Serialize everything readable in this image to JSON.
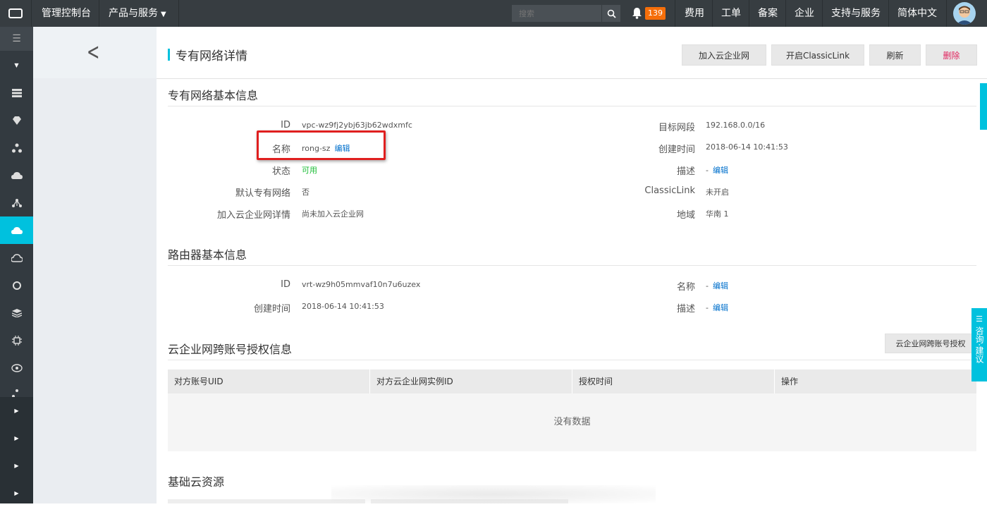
{
  "topbar": {
    "console": "管理控制台",
    "products": "产品与服务",
    "search_placeholder": "搜索",
    "notif_count": "139",
    "menu": [
      "费用",
      "工单",
      "备案",
      "企业",
      "支持与服务",
      "简体中文"
    ]
  },
  "page": {
    "title": "专有网络详情",
    "actions": {
      "join": "加入云企业网",
      "classiclink": "开启ClassicLink",
      "refresh": "刷新",
      "delete": "删除"
    }
  },
  "vpc": {
    "section": "专有网络基本信息",
    "id_label": "ID",
    "id_value": "vpc-wz9fj2ybj63jb62wdxmfc",
    "name_label": "名称",
    "name_value": "rong-sz",
    "name_edit": "编辑",
    "status_label": "状态",
    "status_value": "可用",
    "default_label": "默认专有网络",
    "default_value": "否",
    "cen_label": "加入云企业网详情",
    "cen_value": "尚未加入云企业网",
    "cidr_label": "目标网段",
    "cidr_value": "192.168.0.0/16",
    "created_label": "创建时间",
    "created_value": "2018-06-14 10:41:53",
    "desc_label": "描述",
    "desc_value": "-",
    "desc_edit": "编辑",
    "classiclink_label": "ClassicLink",
    "classiclink_value": "未开启",
    "region_label": "地域",
    "region_value": "华南 1"
  },
  "router": {
    "section": "路由器基本信息",
    "id_label": "ID",
    "id_value": "vrt-wz9h05mmvaf10n7u6uzex",
    "created_label": "创建时间",
    "created_value": "2018-06-14 10:41:53",
    "name_label": "名称",
    "name_value": "-",
    "name_edit": "编辑",
    "desc_label": "描述",
    "desc_value": "-",
    "desc_edit": "编辑"
  },
  "auth": {
    "section": "云企业网跨账号授权信息",
    "button": "云企业网跨账号授权",
    "columns": [
      "对方账号UID",
      "对方云企业网实例ID",
      "授权时间",
      "操作"
    ],
    "empty": "没有数据"
  },
  "resources": {
    "section": "基础云资源"
  },
  "side_tab": "咨询·建议",
  "colors": {
    "accent": "#00c1de",
    "topbar": "#373d41",
    "link": "#0070cc",
    "danger": "#e0245e",
    "badge": "#f56e0a"
  }
}
